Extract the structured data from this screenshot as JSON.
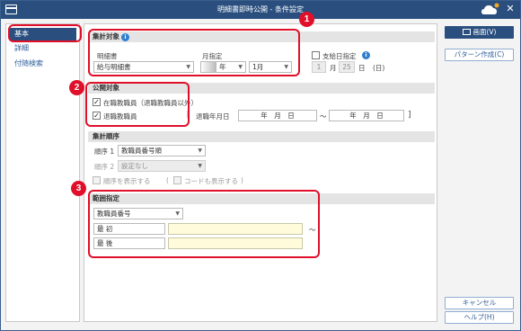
{
  "window": {
    "title": "明細書即時公開 - 条件設定"
  },
  "nav": {
    "items": [
      {
        "label": "基本"
      },
      {
        "label": "詳細"
      },
      {
        "label": "付随検索"
      }
    ]
  },
  "section_target": {
    "title": "集計対象",
    "statement_label": "明細書",
    "statement_value": "給与明細書",
    "month_label": "月指定",
    "year_suffix": "年",
    "month_value": "1月",
    "payday_label": "支給日指定",
    "payday_month_value": "1",
    "payday_month_unit": "月",
    "payday_day_value": "25",
    "payday_day_unit": "日",
    "payday_weekday": "(日)"
  },
  "section_publish": {
    "title": "公開対象",
    "current_label": "在職教職員（退職教職員以外）",
    "retired_label": "退職教職員",
    "bracket_open": "[",
    "retire_date_label": "退職年月日",
    "date_from": "年　月　日",
    "tilde": "～",
    "date_to": "年　月　日",
    "bracket_close": "]"
  },
  "section_order": {
    "title": "集計順序",
    "order1_label": "順序 1",
    "order1_value": "教職員番号順",
    "order2_label": "順序 2",
    "order2_value": "設定なし",
    "show_order_label": "順序を表示する",
    "paren_open": "(",
    "show_code_label": "コードも表示する",
    "paren_close": ")"
  },
  "section_range": {
    "title": "範囲指定",
    "key_value": "教職員番号",
    "first_label": "最 初",
    "last_label": "最 後",
    "tilde": "～"
  },
  "buttons": {
    "screen": "画面(V)",
    "pattern": "パターン作成(C)",
    "cancel": "キャンセル",
    "help": "ヘルプ(H)"
  },
  "callouts": {
    "one": "1",
    "two": "2",
    "three": "3"
  },
  "colors": {
    "titlebar": "#2a4f7f",
    "highlight": "#e0102a",
    "accent": "#2e7fcf"
  }
}
